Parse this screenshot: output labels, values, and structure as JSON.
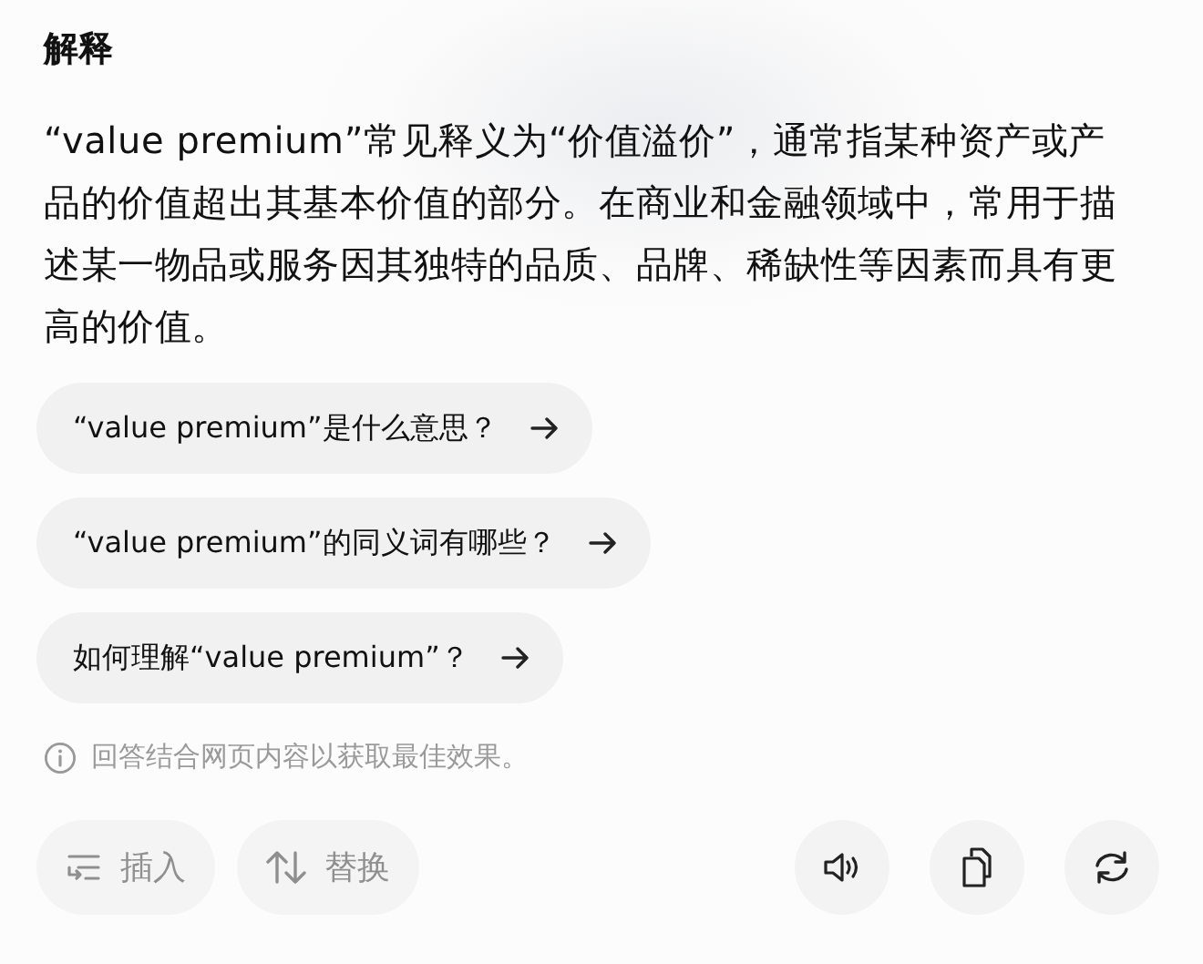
{
  "title": "解释",
  "explanation": "“value premium”常见释义为“价值溢价”，通常指某种资产或产品的价值超出其基本价值的部分。在商业和金融领域中，常用于描述某一物品或服务因其独特的品质、品牌、稀缺性等因素而具有更高的价值。",
  "suggestions": [
    {
      "label": "“value premium”是什么意思？"
    },
    {
      "label": "“value premium”的同义词有哪些？"
    },
    {
      "label": "如何理解“value premium”？"
    }
  ],
  "note": "回答结合网页内容以获取最佳效果。",
  "actions": [
    {
      "kind": "insert",
      "label": "插入",
      "disabled": true
    },
    {
      "kind": "replace",
      "label": "替换",
      "disabled": true
    }
  ],
  "tools": [
    {
      "kind": "speak"
    },
    {
      "kind": "copy"
    },
    {
      "kind": "regenerate"
    }
  ]
}
